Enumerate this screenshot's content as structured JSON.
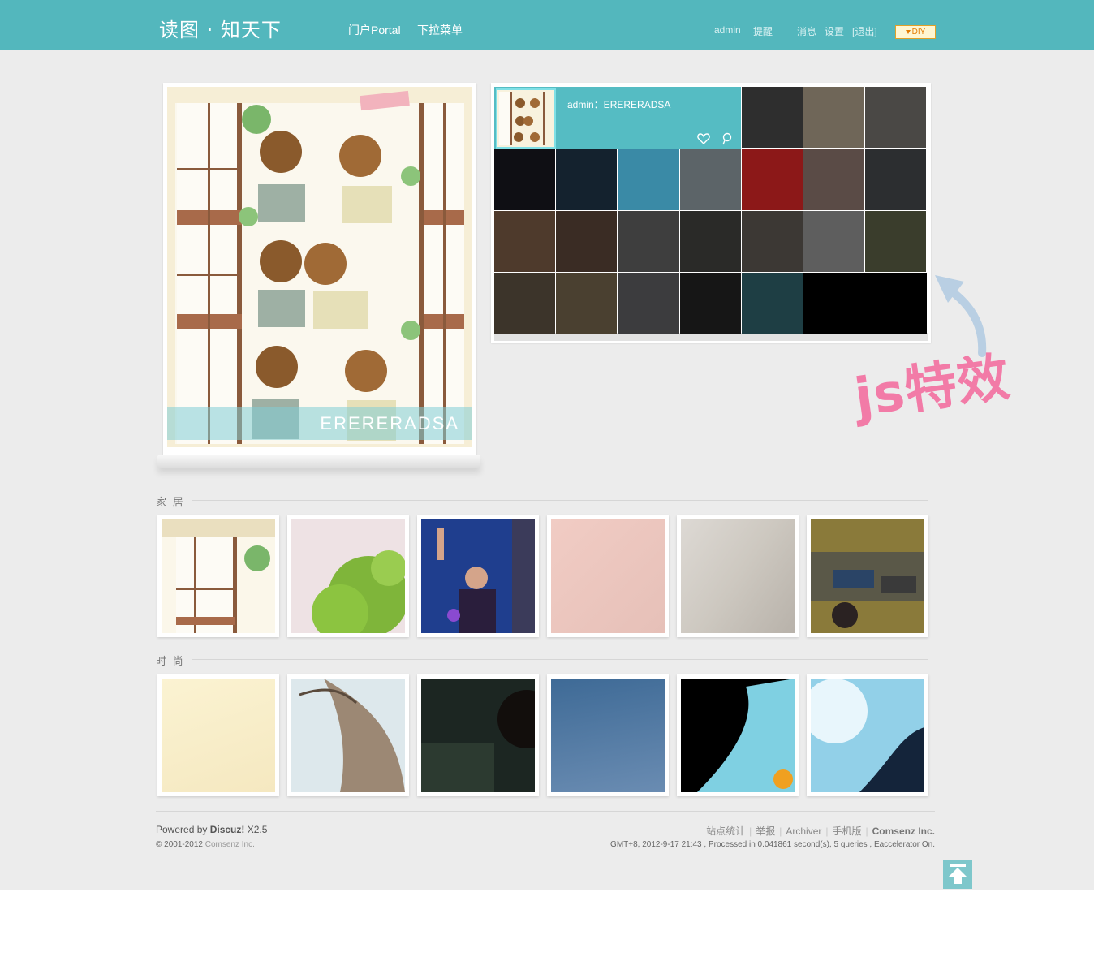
{
  "colors": {
    "header": "#53b7bd",
    "page_bg": "#ececec",
    "accent_pink": "#f27ba7",
    "panel": "#55bcc3"
  },
  "header": {
    "logo": "读图 · 知天下",
    "nav": [
      {
        "label": "门户Portal"
      },
      {
        "label": "下拉菜单"
      }
    ],
    "user": {
      "name": "admin",
      "remind": "提醒",
      "messages": "消息",
      "settings": "设置",
      "logout": "[退出]",
      "diy": "DIY"
    }
  },
  "feature": {
    "caption": "ERERERADSA",
    "active_title": "admin：ERERERADSA"
  },
  "annotation": {
    "text": "js特效"
  },
  "sections": [
    {
      "title": "家 居"
    },
    {
      "title": "时 尚"
    }
  ],
  "footer": {
    "powered_prefix": "Powered by ",
    "powered_brand": "Discuz!",
    "powered_version": " X2.5",
    "copyright_prefix": "© 2001-2012 ",
    "copyright_company": "Comsenz Inc.",
    "links": [
      "站点统计",
      "举报",
      "Archiver",
      "手机版"
    ],
    "company": "Comsenz Inc.",
    "stats": "GMT+8, 2012-9-17 21:43 , Processed in 0.041861 second(s), 5 queries , Eaccelerator On."
  },
  "icons": {
    "heart": "heart-icon",
    "pin": "pin-icon",
    "top": "back-to-top-icon",
    "arrow": "curved-arrow-icon"
  }
}
